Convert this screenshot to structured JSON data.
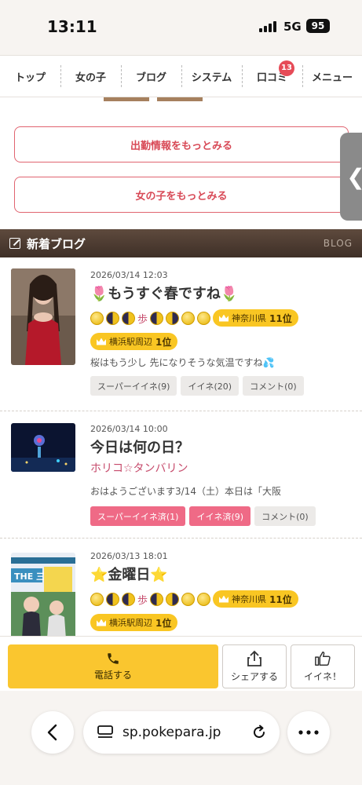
{
  "status_bar": {
    "time": "13:11",
    "network": "5G",
    "battery": "95"
  },
  "nav": {
    "items": [
      {
        "label": "トップ"
      },
      {
        "label": "女の子"
      },
      {
        "label": "ブログ"
      },
      {
        "label": "システム"
      },
      {
        "label": "口コミ",
        "badge": "13"
      },
      {
        "label": "メニュー"
      }
    ]
  },
  "main": {
    "more_schedule": "出勤情報をもっとみる",
    "more_girls": "女の子をもっとみる",
    "section_title": "新着ブログ",
    "section_en": "BLOG",
    "posts": [
      {
        "date": "2026/03/14 12:03",
        "title": "🌷もうすぐ春ですね🌷",
        "ayumi": "歩",
        "rank1_area": "神奈川県",
        "rank1_pos": "11位",
        "rank2_area": "横浜駅周辺",
        "rank2_pos": "1位",
        "excerpt": "桜はもう少し 先になりそうな気温ですね💦",
        "tags": [
          "スーパーイイネ(9)",
          "イイネ(20)",
          "コメント(0)"
        ]
      },
      {
        "date": "2026/03/14 10:00",
        "title": "今日は何の日？",
        "author": "ホリコ☆タンバリン",
        "excerpt": "おはようございます3/14（土）本日は「大阪",
        "tags": [
          "スーパーイイネ済(1)",
          "イイネ済(9)",
          "コメント(0)"
        ]
      },
      {
        "date": "2026/03/13 18:01",
        "title": "⭐金曜日⭐",
        "ayumi": "歩",
        "rank1_area": "神奈川県",
        "rank1_pos": "11位",
        "rank2_area": "横浜駅周辺",
        "rank2_pos": "1位",
        "thumb_text": "THE 三者面談"
      }
    ]
  },
  "actions": {
    "call": "電話する",
    "share": "シェアする",
    "like": "イイネ！"
  },
  "browser": {
    "url": "sp.pokepara.jp"
  }
}
